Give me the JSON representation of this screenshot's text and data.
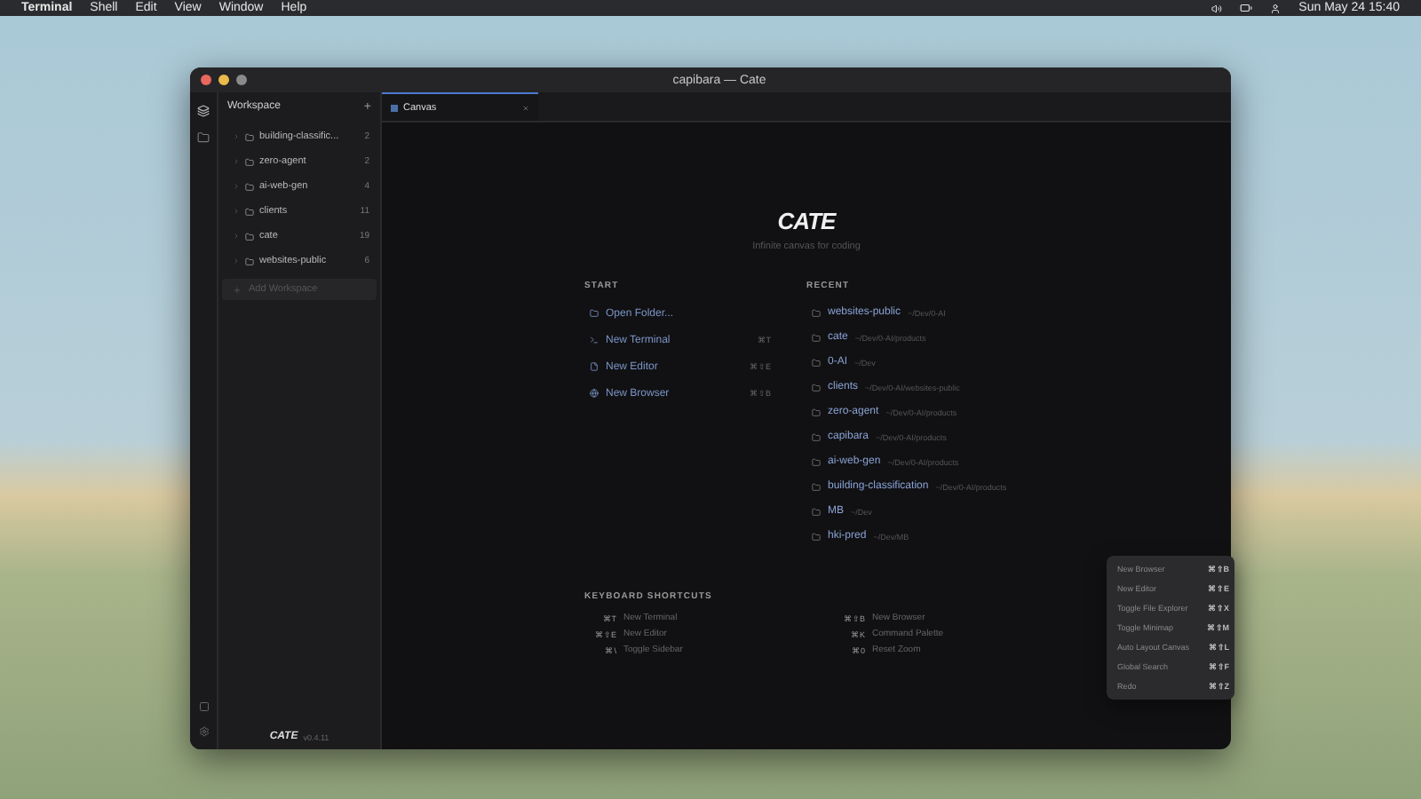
{
  "menu_bar": {
    "app": "Terminal",
    "items": [
      "Shell",
      "Edit",
      "View",
      "Window",
      "Help"
    ],
    "clock": "Sun May 24 15:40"
  },
  "window": {
    "title": "capibara — Cate"
  },
  "sidebar": {
    "title": "Workspace",
    "add": "+",
    "items": [
      {
        "name": "building-classific...",
        "count": "2"
      },
      {
        "name": "zero-agent",
        "count": "2"
      },
      {
        "name": "ai-web-gen",
        "count": "4"
      },
      {
        "name": "clients",
        "count": "11"
      },
      {
        "name": "cate",
        "count": "19"
      },
      {
        "name": "websites-public",
        "count": "6"
      }
    ],
    "add_workspace": "Add Workspace",
    "logo": "CATE",
    "version": "v0.4.11"
  },
  "tabs": [
    {
      "label": "Canvas",
      "selected": true
    }
  ],
  "welcome": {
    "logo": "CATE",
    "tagline": "Infinite canvas for coding",
    "start_title": "START",
    "start": [
      {
        "kind": "folder",
        "label": "Open Folder..."
      },
      {
        "kind": "terminal",
        "label": "New Terminal",
        "shortcut": "⌘T"
      },
      {
        "kind": "editor",
        "label": "New Editor",
        "shortcut": "⌘⇧E"
      },
      {
        "kind": "browser",
        "label": "New Browser",
        "shortcut": "⌘⇧B"
      }
    ],
    "recent_title": "RECENT",
    "recent": [
      {
        "name": "websites-public",
        "path": "~/Dev/0-AI"
      },
      {
        "name": "cate",
        "path": "~/Dev/0-AI/products"
      },
      {
        "name": "0-AI",
        "path": "~/Dev"
      },
      {
        "name": "clients",
        "path": "~/Dev/0-AI/websites-public"
      },
      {
        "name": "zero-agent",
        "path": "~/Dev/0-AI/products"
      },
      {
        "name": "capibara",
        "path": "~/Dev/0-AI/products"
      },
      {
        "name": "ai-web-gen",
        "path": "~/Dev/0-AI/products"
      },
      {
        "name": "building-classification",
        "path": "~/Dev/0-AI/products"
      },
      {
        "name": "MB",
        "path": "~/Dev"
      },
      {
        "name": "hki-pred",
        "path": "~/Dev/MB"
      }
    ],
    "shortcuts_title": "KEYBOARD SHORTCUTS",
    "shortcuts": [
      {
        "keys": "⌘T",
        "label": "New Terminal"
      },
      {
        "keys": "⌘⇧B",
        "label": "New Browser"
      },
      {
        "keys": "⌘⇧E",
        "label": "New Editor"
      },
      {
        "keys": "⌘K",
        "label": "Command Palette"
      },
      {
        "keys": "⌘\\",
        "label": "Toggle Sidebar"
      },
      {
        "keys": "⌘0",
        "label": "Reset Zoom"
      }
    ]
  },
  "context_menu": [
    {
      "label": "New Browser",
      "keys": "⌘⇧B"
    },
    {
      "label": "New Editor",
      "keys": "⌘⇧E"
    },
    {
      "label": "Toggle File Explorer",
      "keys": "⌘⇧X"
    },
    {
      "label": "Toggle Minimap",
      "keys": "⌘⇧M"
    },
    {
      "label": "Auto Layout Canvas",
      "keys": "⌘⇧L"
    },
    {
      "label": "Global Search",
      "keys": "⌘⇧F"
    },
    {
      "label": "Redo",
      "keys": "⌘⇧Z"
    }
  ]
}
